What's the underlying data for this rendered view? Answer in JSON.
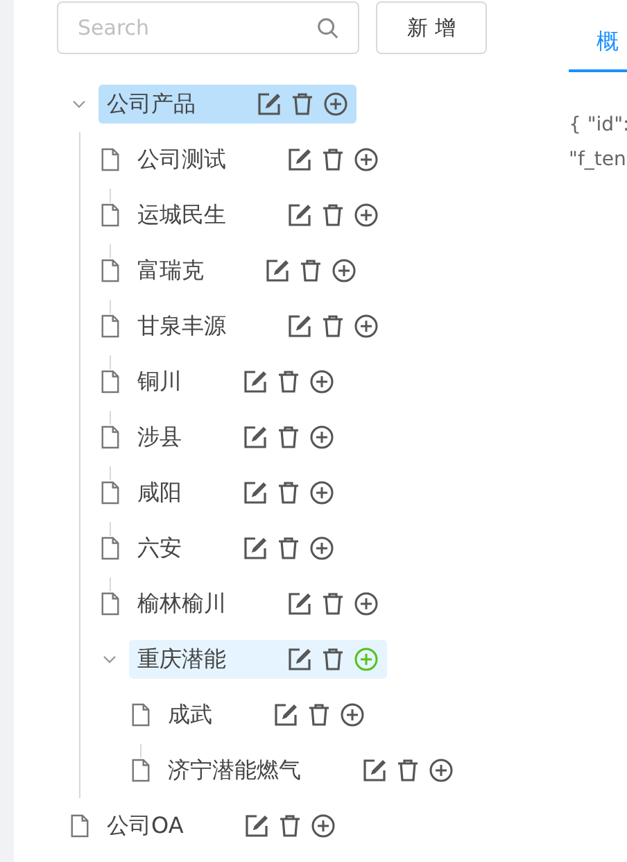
{
  "search": {
    "placeholder": "Search"
  },
  "add_button": "新 增",
  "tree": [
    {
      "label": "公司产品",
      "expanded": true,
      "selected": true,
      "hovered": false,
      "children": [
        {
          "label": "公司测试",
          "selected": false,
          "hovered": false
        },
        {
          "label": "运城民生",
          "selected": false,
          "hovered": false
        },
        {
          "label": "富瑞克",
          "selected": false,
          "hovered": false
        },
        {
          "label": "甘泉丰源",
          "selected": false,
          "hovered": false
        },
        {
          "label": "铜川",
          "selected": false,
          "hovered": false
        },
        {
          "label": "涉县",
          "selected": false,
          "hovered": false
        },
        {
          "label": "咸阳",
          "selected": false,
          "hovered": false
        },
        {
          "label": "六安",
          "selected": false,
          "hovered": false
        },
        {
          "label": "榆林榆川",
          "selected": false,
          "hovered": false
        },
        {
          "label": "重庆潜能",
          "expanded": true,
          "selected": false,
          "hovered": true,
          "children": [
            {
              "label": "成武",
              "selected": false,
              "hovered": false
            },
            {
              "label": "济宁潜能燃气",
              "selected": false,
              "hovered": false
            }
          ]
        }
      ]
    },
    {
      "label": "公司OA",
      "selected": false,
      "hovered": false
    }
  ],
  "tabs": [
    {
      "label": "概",
      "selected": true
    }
  ],
  "detail_lines": [
    "{ \"id\":",
    "\"f_ten"
  ]
}
